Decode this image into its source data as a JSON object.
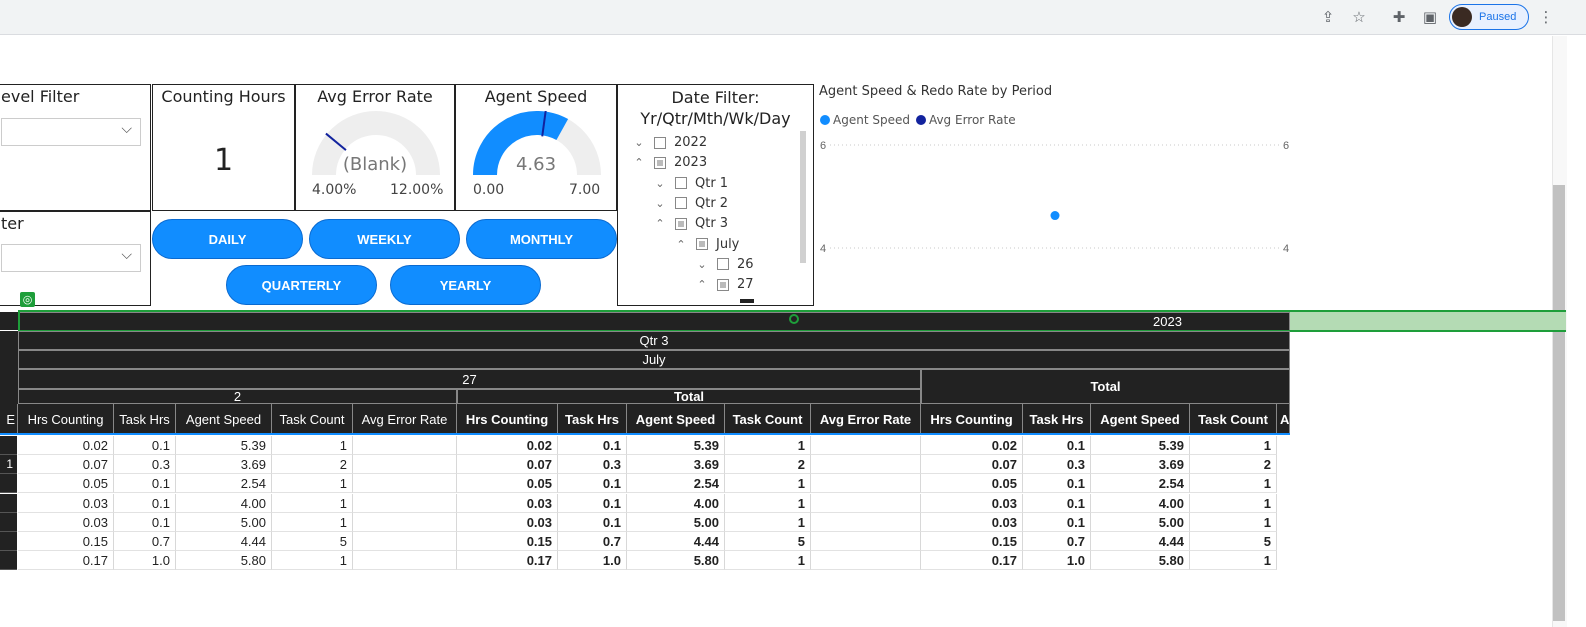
{
  "browser": {
    "profile_label": "Paused"
  },
  "filters": {
    "level_filter_title": "evel Filter",
    "second_filter_title": "ter"
  },
  "kpi": {
    "counting_hours_title": "Counting Hours",
    "counting_hours_value": "1",
    "avg_error_rate_title": "Avg Error Rate",
    "avg_error_rate_value": "(Blank)",
    "avg_error_rate_min": "4.00%",
    "avg_error_rate_max": "12.00%",
    "agent_speed_title": "Agent Speed",
    "agent_speed_value": "4.63",
    "agent_speed_min": "0.00",
    "agent_speed_max": "7.00",
    "agent_speed_gauge": {
      "value": 4.63,
      "min": 0,
      "max": 7,
      "target": 3.8
    },
    "error_gauge_target_fraction": 0.22
  },
  "period_buttons": {
    "daily": "DAILY",
    "weekly": "WEEKLY",
    "monthly": "MONTHLY",
    "quarterly": "QUARTERLY",
    "yearly": "YEARLY"
  },
  "date_filter": {
    "title_line1": "Date Filter:",
    "title_line2": "Yr/Qtr/Mth/Wk/Day",
    "rows": [
      {
        "label": "2022",
        "state": "empty",
        "chevron": "down"
      },
      {
        "label": "2023",
        "state": "partial",
        "chevron": "up"
      },
      {
        "label": "Qtr 1",
        "state": "empty",
        "chevron": "down"
      },
      {
        "label": "Qtr 2",
        "state": "empty",
        "chevron": "down"
      },
      {
        "label": "Qtr 3",
        "state": "partial",
        "chevron": "up"
      },
      {
        "label": "July",
        "state": "partial",
        "chevron": "up"
      },
      {
        "label": "26",
        "state": "empty",
        "chevron": "down"
      },
      {
        "label": "27",
        "state": "partial",
        "chevron": "up"
      }
    ]
  },
  "chart_data": {
    "type": "scatter",
    "title": "Agent Speed & Redo Rate by Period",
    "legend": [
      "Agent Speed",
      "Avg Error Rate"
    ],
    "legend_position": "top-left",
    "colors": {
      "Agent Speed": "#118dff",
      "Avg Error Rate": "#12239e"
    },
    "y_ticks_left": [
      "6",
      "4"
    ],
    "y_ticks_right": [
      "6",
      "4"
    ],
    "ylim": [
      3.5,
      6.3
    ],
    "series": [
      {
        "name": "Agent Speed",
        "points": [
          {
            "x": 0.5,
            "y": 4.63
          }
        ]
      }
    ],
    "grid": true
  },
  "matrix": {
    "year": "2023",
    "quarter": "Qtr 3",
    "month": "July",
    "week": "27",
    "day": "2",
    "total_label": "Total",
    "col_headers": [
      "Hrs Counting",
      "Task Hrs",
      "Agent Speed",
      "Task Count",
      "Avg Error Rate"
    ],
    "row_header_fragments": [
      "E",
      "",
      "1",
      "",
      "",
      "",
      "",
      ""
    ],
    "cut_header": "A",
    "rows": [
      [
        "0.02",
        "0.1",
        "5.39",
        "1",
        ""
      ],
      [
        "0.07",
        "0.3",
        "3.69",
        "2",
        ""
      ],
      [
        "0.05",
        "0.1",
        "2.54",
        "1",
        ""
      ],
      [
        "0.03",
        "0.1",
        "4.00",
        "1",
        ""
      ],
      [
        "0.03",
        "0.1",
        "5.00",
        "1",
        ""
      ],
      [
        "0.15",
        "0.7",
        "4.44",
        "5",
        ""
      ],
      [
        "0.17",
        "1.0",
        "5.80",
        "1",
        ""
      ]
    ]
  }
}
